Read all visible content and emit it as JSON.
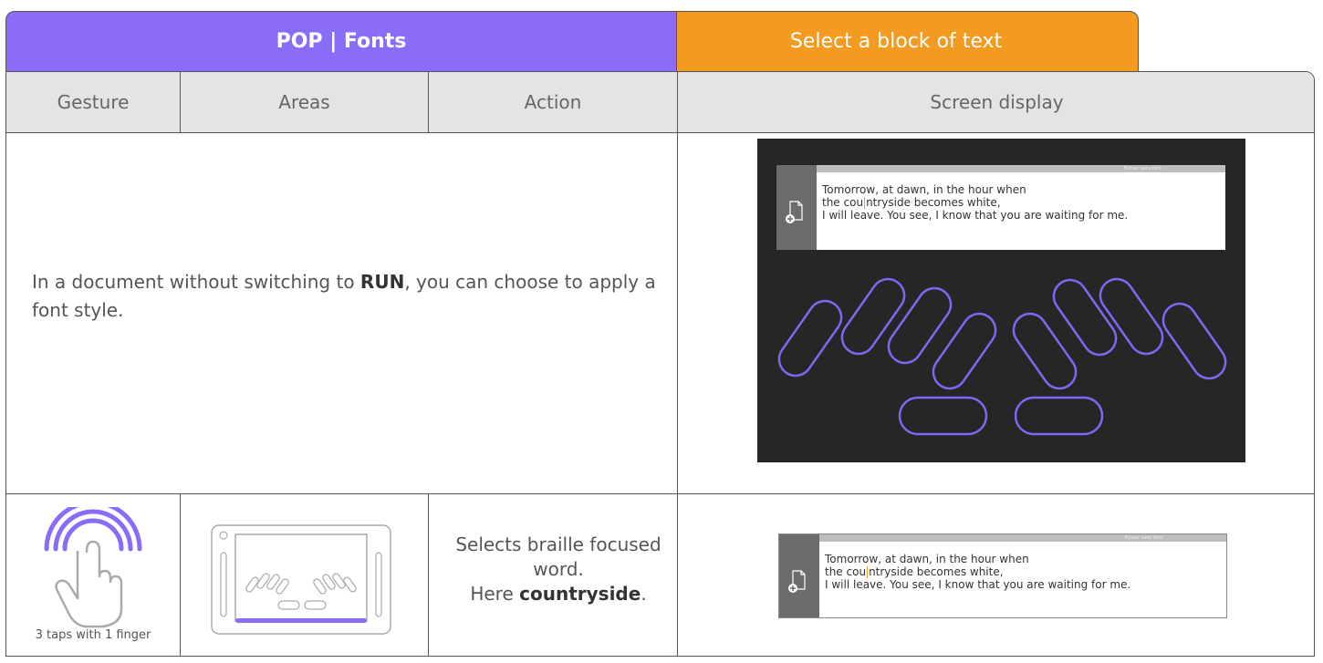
{
  "header": {
    "title_tab": "POP | Fonts",
    "task_tab": "Select a block of text"
  },
  "columns": {
    "gesture": "Gesture",
    "areas": "Areas",
    "action": "Action",
    "screen_display": "Screen display"
  },
  "intro": {
    "text_before": "In a document without switching to ",
    "keyword": "RUN",
    "text_after": ", you can choose to apply a font style."
  },
  "document": {
    "filename": "Fichier sans titre",
    "line1": "Tomorrow, at dawn, in the hour when",
    "line2_before_cursor": "the cou",
    "line2_after_cursor": "ntryside becomes white,",
    "line3": "I will leave. You see, I know that you are waiting for me."
  },
  "gesture": {
    "label": "3 taps with 1 finger",
    "icon": "triple-tap-hand-icon"
  },
  "areas": {
    "icon": "braille-tablet-icon"
  },
  "action": {
    "line1": "Selects braille focused word.",
    "line2_prefix": "Here ",
    "keyword": "countryside",
    "suffix": "."
  },
  "colors": {
    "purple": "#8a6cf9",
    "orange": "#f39a20",
    "header_gray": "#e4e4e6",
    "screen_dark": "#262626"
  }
}
